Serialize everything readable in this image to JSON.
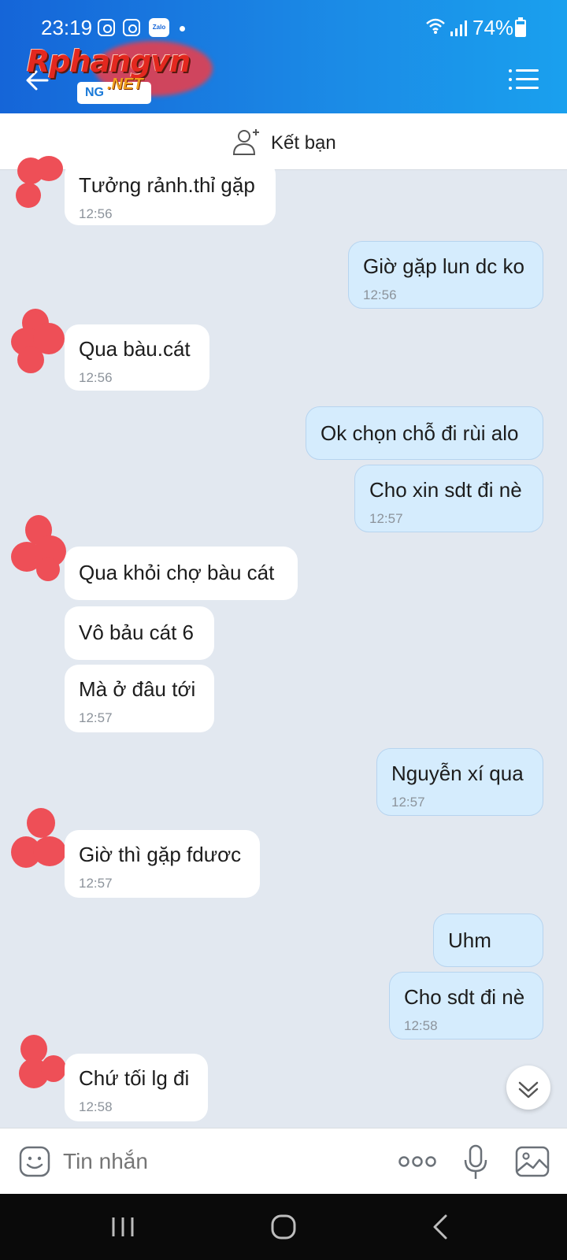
{
  "status_bar": {
    "time": "23:19",
    "battery": "74%",
    "zalo_label": "Zalo"
  },
  "header": {
    "logo_text": "Rphangvn",
    "logo_subtext": ".NET",
    "chip_text": "NG",
    "back_icon": "arrow-left-icon",
    "menu_icon": "list-menu-icon"
  },
  "add_friend": {
    "label": "Kết bạn",
    "icon": "add-person-icon"
  },
  "messages": [
    {
      "side": "in",
      "text": "Tưởng rảnh.thỉ gặp",
      "time": "12:56"
    },
    {
      "side": "out",
      "text": "Giờ gặp lun dc ko",
      "time": "12:56"
    },
    {
      "side": "in",
      "text": "Qua bàu.cát",
      "time": "12:56"
    },
    {
      "side": "out",
      "text": "Ok chọn chỗ đi rùi alo",
      "time": ""
    },
    {
      "side": "out",
      "text": "Cho xin sdt đi nè",
      "time": "12:57"
    },
    {
      "side": "in",
      "text": "Qua khỏi chợ bàu cát",
      "time": ""
    },
    {
      "side": "in",
      "text": "Vô bảu cát 6",
      "time": ""
    },
    {
      "side": "in",
      "text": "Mà ở đâu tới",
      "time": "12:57"
    },
    {
      "side": "out",
      "text": "Nguyễn xí qua",
      "time": "12:57"
    },
    {
      "side": "in",
      "text": "Giờ thì gặp fdươc",
      "time": "12:57"
    },
    {
      "side": "out",
      "text": "Uhm",
      "time": ""
    },
    {
      "side": "out",
      "text": "Cho sdt đi nè",
      "time": "12:58"
    },
    {
      "side": "in",
      "text": "Chứ tối lg đi",
      "time": "12:58"
    }
  ],
  "composer": {
    "placeholder": "Tin nhắn",
    "emoji_icon": "emoji-sticker-icon",
    "more_icon": "more-dots-icon",
    "mic_icon": "microphone-icon",
    "image_icon": "image-icon"
  },
  "colors": {
    "header_blue": "#1b8be6",
    "incoming_bubble": "#ffffff",
    "outgoing_bubble": "#d5ecfd",
    "chat_background": "#e2e8f0",
    "avatar_blur": "#ee4f57"
  }
}
